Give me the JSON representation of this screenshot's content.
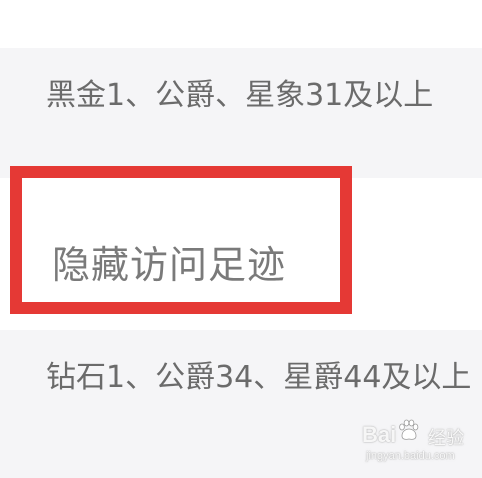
{
  "top_spacer": {},
  "rows": [
    {
      "description": "黑金1、公爵、星象31及以上"
    },
    {
      "setting_title": "隐藏访问足迹"
    },
    {
      "description": "钻石1、公爵34、星爵44及以上"
    }
  ],
  "highlight": {
    "color": "#e53935"
  },
  "watermark": {
    "brand": "Bai",
    "sub": "经验",
    "url": "jingyan.baidu.com",
    "icon": "paw-icon"
  }
}
